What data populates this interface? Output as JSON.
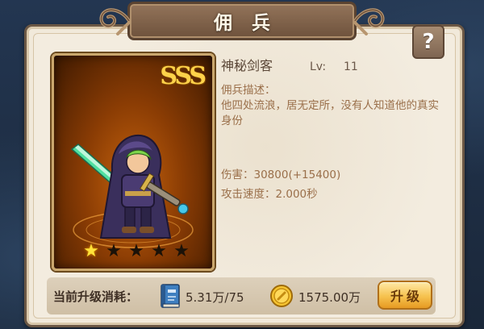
{
  "window": {
    "title": "佣 兵"
  },
  "help": {
    "label": "?"
  },
  "hero": {
    "rank": "SSS",
    "name": "神秘剑客",
    "level_label": "Lv:",
    "level": "11",
    "description_title": "佣兵描述：",
    "description": "他四处流浪，居无定所，没有人知道他的真实身份",
    "stars_filled": 1,
    "stars_total": 5,
    "stars": [
      "★",
      "★",
      "★",
      "★",
      "★"
    ]
  },
  "stats": {
    "damage": "伤害：30800(+15400)",
    "attack_speed": "攻击速度：2.000秒"
  },
  "upgrade": {
    "cost_label": "当前升级消耗：",
    "exp_book_cost": "5.31万/75",
    "gold_cost": "1575.00万",
    "button_label": "升级"
  },
  "colors": {
    "panel_bg": "#f1e9da",
    "card_glow": "#c5630d",
    "rank_gold": "#ffd24a",
    "star_on": "#ffe23a",
    "button_gold": "#f6c24f"
  },
  "icons": {
    "help": "question-icon",
    "exp_book": "book-icon",
    "gold": "gold-coin-icon",
    "star": "star-icon"
  }
}
